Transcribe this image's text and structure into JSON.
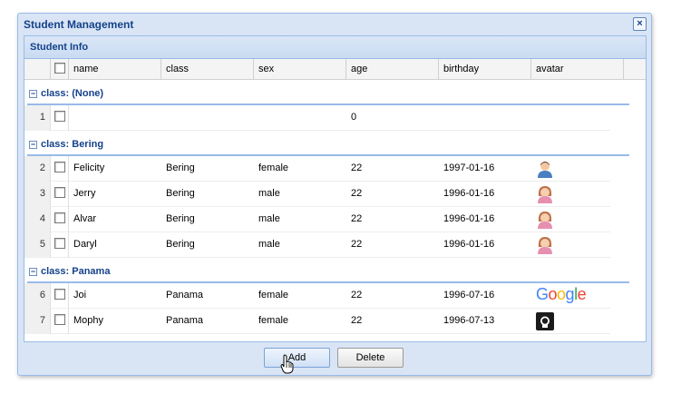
{
  "window": {
    "title": "Student Management",
    "close_glyph": "×"
  },
  "panel": {
    "title": "Student Info"
  },
  "columns": [
    "name",
    "class",
    "sex",
    "age",
    "birthday",
    "avatar"
  ],
  "groups": [
    {
      "label": "class: (None)",
      "rows": [
        {
          "num": "1",
          "name": "",
          "class": "",
          "sex": "",
          "age": "0",
          "birthday": "",
          "avatar": ""
        }
      ]
    },
    {
      "label": "class: Bering",
      "rows": [
        {
          "num": "2",
          "name": "Felicity",
          "class": "Bering",
          "sex": "female",
          "age": "22",
          "birthday": "1997-01-16",
          "avatar": "user-male-icon"
        },
        {
          "num": "3",
          "name": "Jerry",
          "class": "Bering",
          "sex": "male",
          "age": "22",
          "birthday": "1996-01-16",
          "avatar": "user-female-icon"
        },
        {
          "num": "4",
          "name": "Alvar",
          "class": "Bering",
          "sex": "male",
          "age": "22",
          "birthday": "1996-01-16",
          "avatar": "user-female-icon"
        },
        {
          "num": "5",
          "name": "Daryl",
          "class": "Bering",
          "sex": "male",
          "age": "22",
          "birthday": "1996-01-16",
          "avatar": "user-female-icon"
        }
      ]
    },
    {
      "label": "class: Panama",
      "rows": [
        {
          "num": "6",
          "name": "Joi",
          "class": "Panama",
          "sex": "female",
          "age": "22",
          "birthday": "1996-07-16",
          "avatar": "google-logo"
        },
        {
          "num": "7",
          "name": "Mophy",
          "class": "Panama",
          "sex": "female",
          "age": "22",
          "birthday": "1996-07-13",
          "avatar": "github-logo"
        }
      ]
    }
  ],
  "google_text": "Google",
  "buttons": {
    "add": "Add",
    "delete": "Delete"
  },
  "colors": {
    "header_text": "#15428b",
    "border": "#99bbe8",
    "window_bg": "#d9e5f5"
  }
}
